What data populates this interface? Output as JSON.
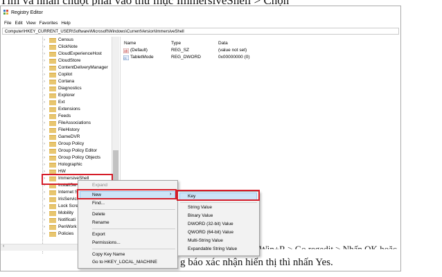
{
  "page_text": {
    "top_caption": "Tìm và nhấn chuột phải vào thư mục ImmersiveShell > Chọn",
    "bottom_line_1": "Win+R > Go regedit > Nhấn OK hoặc",
    "bottom_line_2": "g báo xác nhận hiển thị thì nhấn Yes."
  },
  "window": {
    "title": "Registry Editor",
    "menu": [
      "File",
      "Edit",
      "View",
      "Favorites",
      "Help"
    ],
    "address": "Computer\\HKEY_CURRENT_USER\\Software\\Microsoft\\Windows\\CurrentVersion\\ImmersiveShell"
  },
  "tree": {
    "items": [
      "Census",
      "ClickNote",
      "CloudExperienceHost",
      "CloudStore",
      "ContentDeliveryManager",
      "Copilot",
      "Cortana",
      "Diagnostics",
      "Explorer",
      "Ext",
      "Extensions",
      "Feeds",
      "FileAssociations",
      "FileHistory",
      "GameDVR",
      "Group Policy",
      "Group Policy Editor",
      "Group Policy Objects",
      "Holographic",
      "HW",
      "ImmersiveShell",
      "InstallServ",
      "Internet S",
      "IrisService",
      "Lock Scre",
      "Mobility",
      "Notificati",
      "PenWork",
      "Policies"
    ]
  },
  "list": {
    "headers": [
      "Name",
      "Type",
      "Data"
    ],
    "rows": [
      {
        "name": "(Default)",
        "type": "REG_SZ",
        "data": "(value not set)"
      },
      {
        "name": "TabletMode",
        "type": "REG_DWORD",
        "data": "0x00000000 (0)"
      }
    ]
  },
  "context_menu": {
    "items": [
      "Expand",
      "New",
      "Find...",
      "Delete",
      "Rename",
      "Export",
      "Permissions...",
      "Copy Key Name",
      "Go to HKEY_LOCAL_MACHINE"
    ]
  },
  "submenu": {
    "items": [
      "Key",
      "String Value",
      "Binary Value",
      "DWORD (32-bit) Value",
      "QWORD (64-bit) Value",
      "Multi-String Value",
      "Expandable String Value"
    ]
  },
  "colors": {
    "highlight_border": "#d51c28",
    "folder": "#e8c670",
    "selection": "#cce4f7"
  },
  "icons": [
    "registry-editor-icon",
    "folder-icon",
    "chevron-right-icon",
    "string-value-icon",
    "dword-value-icon",
    "submenu-arrow-icon"
  ]
}
